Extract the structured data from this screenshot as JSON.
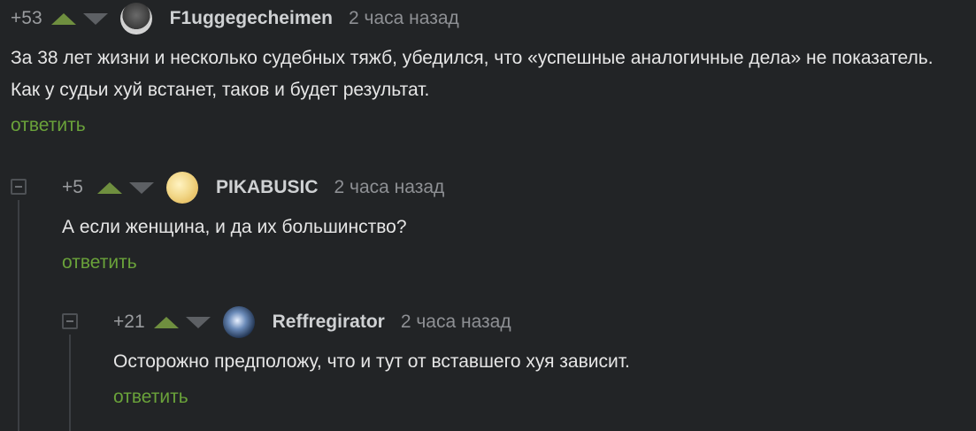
{
  "comments": [
    {
      "rating": "+53",
      "author": "F1uggegecheimen",
      "time": "2 часа назад",
      "text": "За 38 лет жизни и несколько судебных тяжб, убедился, что «успешные аналогичные дела» не показатель. Как у судьи хуй встанет, таков и будет результат.",
      "reply": "ответить",
      "avatar": "avatar-person-icon"
    },
    {
      "rating": "+5",
      "author": "PIKABUSIC",
      "time": "2 часа назад",
      "text": "А если женщина, и да их большинство?",
      "reply": "ответить",
      "avatar": "avatar-yellow-icon"
    },
    {
      "rating": "+21",
      "author": "Reffregirator",
      "time": "2 часа назад",
      "text": "Осторожно предположу, что и тут от вставшего хуя зависит.",
      "reply": "ответить",
      "avatar": "avatar-planet-icon"
    }
  ],
  "colors": {
    "background": "#222426",
    "upvote": "#6f8f3f",
    "downvote": "#5d6064",
    "reply_link": "#6aa23a"
  }
}
